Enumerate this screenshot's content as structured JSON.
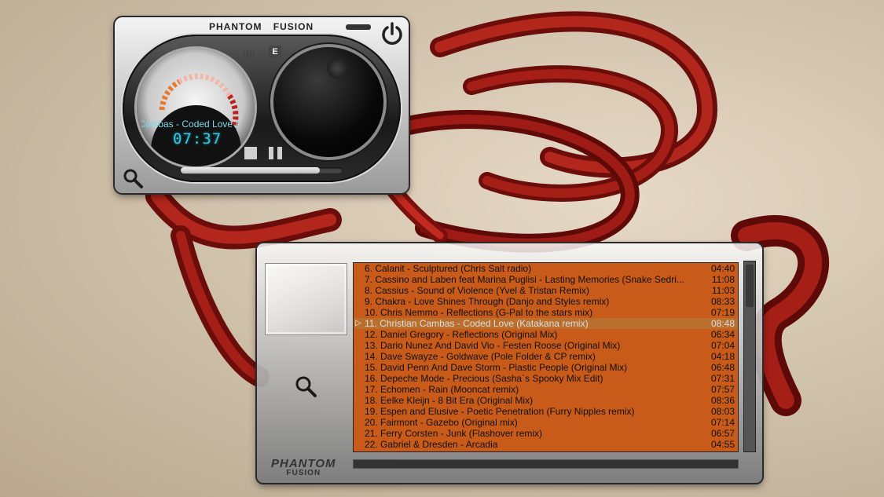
{
  "player": {
    "brand_left": "PHANTOM",
    "brand_right": "FUSION",
    "eq_label": "E",
    "now_playing_scroll": "Cambas - Coded Love (",
    "time": "07:37",
    "progress_fraction": 0.86
  },
  "playlist": {
    "logo_top": "PHANTOM",
    "logo_bottom": "FUSION",
    "tracks": [
      {
        "title": "6. Calanit - Sculptured (Chris Salt radio)",
        "duration": "04:40"
      },
      {
        "title": "7. Cassino and Laben feat Marina Puglisi - Lasting Memories (Snake Sedri...",
        "duration": "11:08"
      },
      {
        "title": "8. Cassius - Sound of Violence (Yvel & Tristan Remix)",
        "duration": "11:03"
      },
      {
        "title": "9. Chakra - Love Shines Through (Danjo and Styles remix)",
        "duration": "08:33"
      },
      {
        "title": "10. Chris Nemmo - Reflections (G-Pal to the stars mix)",
        "duration": "07:19"
      },
      {
        "title": "11. Christian Cambas - Coded Love (Katakana remix)",
        "duration": "08:48"
      },
      {
        "title": "12. Daniel Gregory - Reflections (Original Mix)",
        "duration": "06:34"
      },
      {
        "title": "13. Dario Nunez And David Vio - Festen Roose (Original Mix)",
        "duration": "07:04"
      },
      {
        "title": "14. Dave Swayze - Goldwave (Pole Folder & CP remix)",
        "duration": "04:18"
      },
      {
        "title": "15. David Penn And Dave Storm - Plastic People (Original Mix)",
        "duration": "06:48"
      },
      {
        "title": "16. Depeche Mode - Precious (Sasha`s Spooky Mix Edit)",
        "duration": "07:31"
      },
      {
        "title": "17. Echomen - Rain (Mooncat remix)",
        "duration": "07:57"
      },
      {
        "title": "18. Eelke Kleijn - 8 Bit Era (Original Mix)",
        "duration": "08:36"
      },
      {
        "title": "19. Espen and Elusive - Poetic Penetration (Furry Nipples remix)",
        "duration": "08:03"
      },
      {
        "title": "20. Fairmont - Gazebo (Original mix)",
        "duration": "07:14"
      },
      {
        "title": "21. Ferry Corsten - Junk (Flashover remix)",
        "duration": "06:57"
      },
      {
        "title": "22. Gabriel & Dresden - Arcadia",
        "duration": "04:55"
      }
    ],
    "current_index": 5
  },
  "colors": {
    "list_bg": "#c85a1a",
    "current_row_bg": "#b9702f",
    "lcd_cyan": "#39c7de",
    "vu_red": "#c0201a",
    "vu_orange": "#e8782a"
  }
}
